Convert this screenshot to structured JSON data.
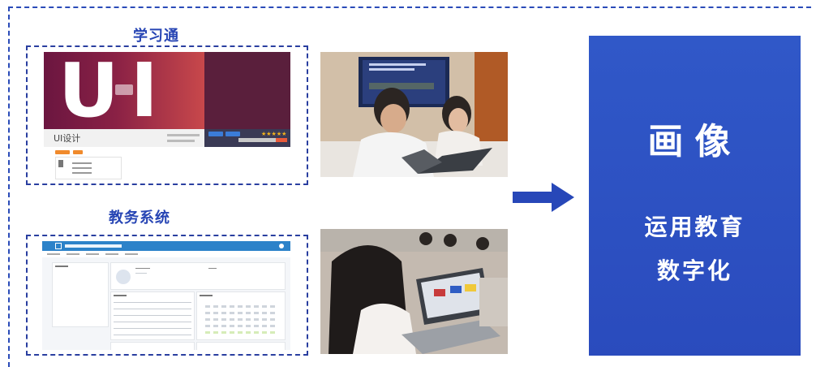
{
  "labels": {
    "xuexitong": "学习通",
    "jiaowu": "教务系统"
  },
  "course_card": {
    "hero_letters": "UI",
    "course_name": "UI设计"
  },
  "right_panel": {
    "title": "画像",
    "line1": "运用教育",
    "line2": "数字化"
  },
  "colors": {
    "accent_blue": "#2a4bb8",
    "panel_blue": "#2d52c4",
    "arrow_blue": "#2747b8"
  }
}
